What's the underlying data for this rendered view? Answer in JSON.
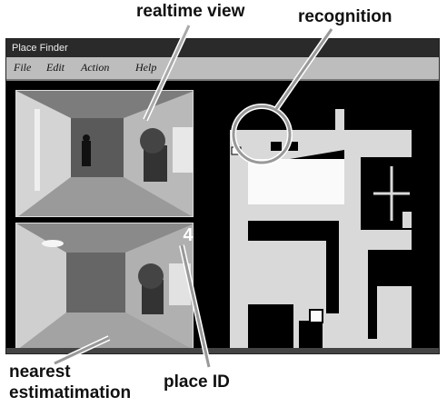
{
  "callouts": {
    "realtime_view": "realtime view",
    "recognition": "recognition",
    "nearest_line1": "nearest",
    "nearest_line2": "estimatimation",
    "place_id": "place ID"
  },
  "window": {
    "title": "Place Finder",
    "menu": [
      "File",
      "Edit",
      "Action",
      "Help"
    ]
  },
  "place_id_value": "4",
  "colors": {
    "background": "#000000",
    "map_floor": "#d9d9d9",
    "menubar": "#bdbdbd"
  }
}
